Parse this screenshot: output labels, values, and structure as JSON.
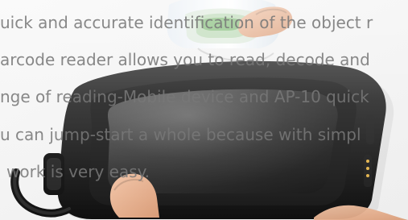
{
  "caption": {
    "lines": [
      "uick and accurate identification of the object r",
      "arcode reader allows you to read, decode and",
      "nge of reading-Mobile device and AP-10 quick",
      "u can jump-start a whole because with simpl",
      "work is very easy."
    ]
  }
}
